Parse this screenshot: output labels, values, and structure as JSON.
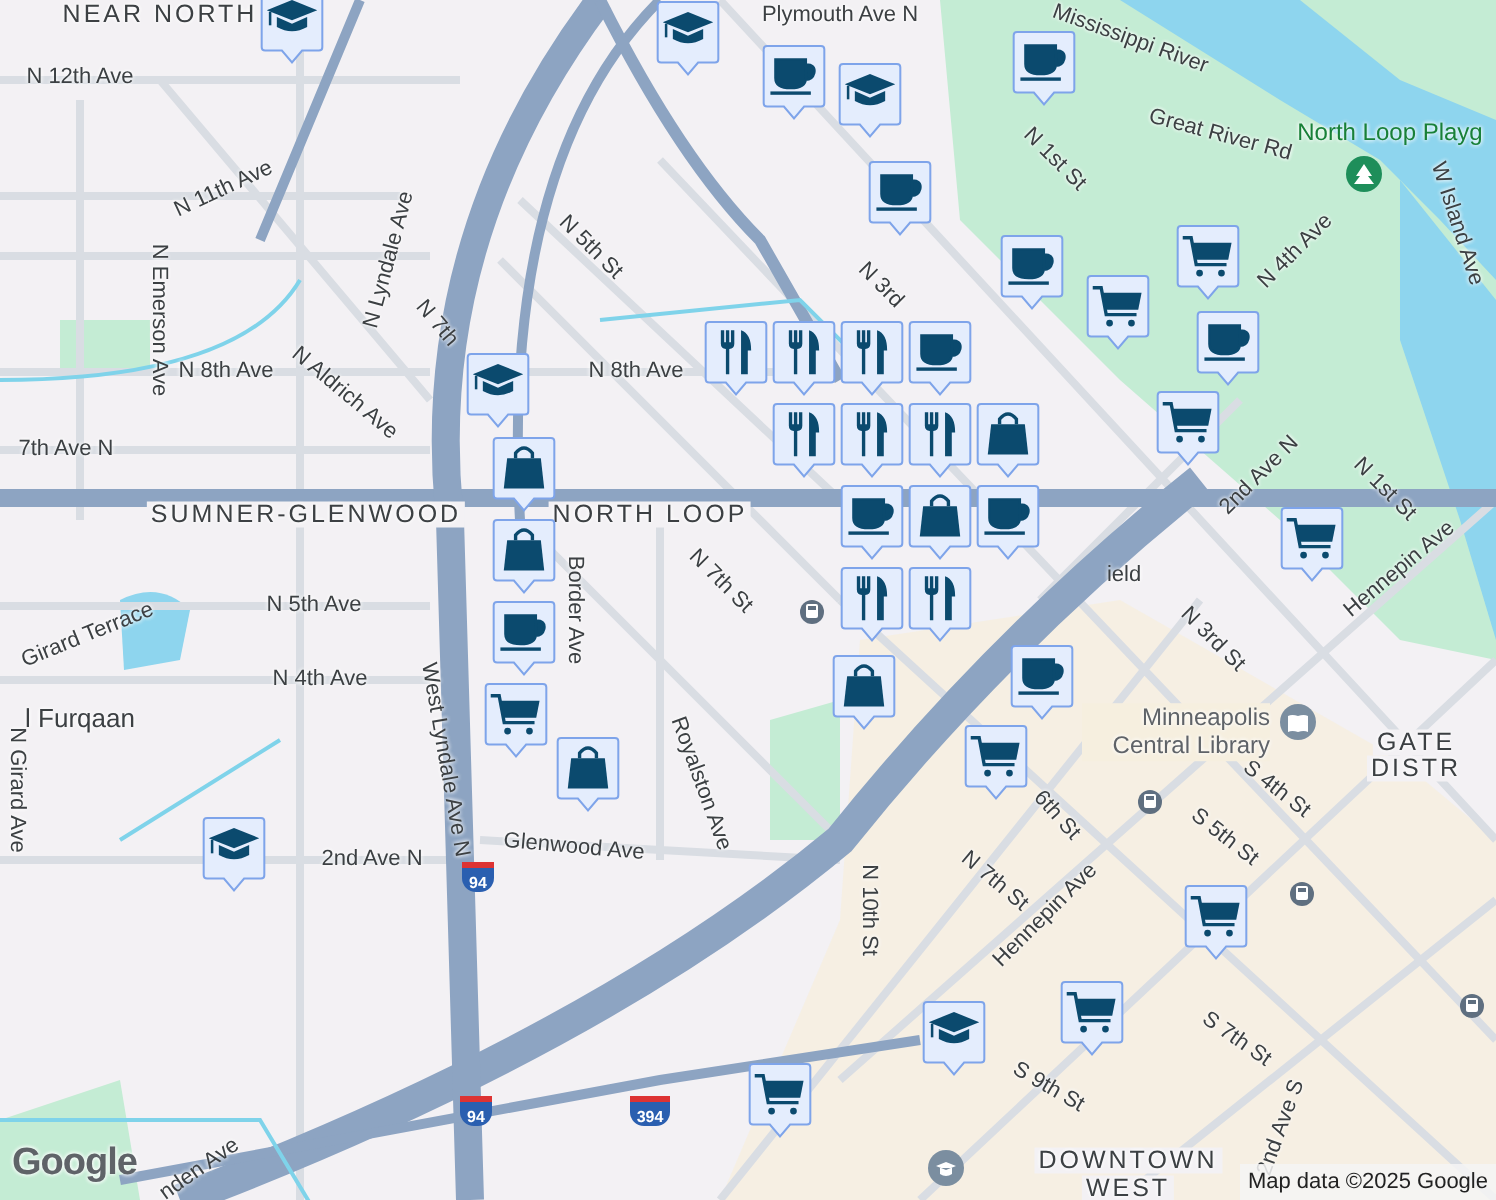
{
  "map": {
    "area_labels": [
      "NEAR NORTH",
      "SUMNER-GLENWOOD",
      "NORTH LOOP",
      "GATE",
      "DISTR",
      "DOWNTOWN",
      "WEST"
    ],
    "street_labels": [
      "N 12th Ave",
      "N 11th Ave",
      "N Emerson Ave",
      "N 8th Ave",
      "N Aldrich Ave",
      "7th Ave N",
      "N Lyndale Ave",
      "N 7th",
      "N 5th St",
      "N 8th Ave",
      "Plymouth Ave N",
      "N 7th St",
      "Border Ave",
      "N 5th Ave",
      "N 4th Ave",
      "Girard Terrace",
      "N Girard Ave",
      "2nd Ave N",
      "West Lyndale Ave N",
      "Glenwood Ave",
      "Royalston Ave",
      "nden Ave",
      "Mississippi River",
      "Great River Rd",
      "N 1st St",
      "N 3rd",
      "N 4th Ave",
      "2nd Ave N",
      "N 1st St",
      "Hennepin Ave",
      "W Island Ave",
      "ield",
      "N 3rd St",
      "S 4th St",
      "S 5th St",
      "6th St",
      "N 7th St",
      "Hennepin Ave",
      "N 10th St",
      "S 7th St",
      "S 9th St",
      "2nd Ave S",
      "l Furqaan"
    ],
    "shields": [
      "94",
      "94",
      "394"
    ],
    "pois": [
      {
        "kind": "park",
        "label": "North Loop Playg"
      },
      {
        "kind": "library",
        "label": "Minneapolis Central Library"
      },
      {
        "kind": "transit"
      },
      {
        "kind": "transit"
      },
      {
        "kind": "transit"
      },
      {
        "kind": "transit"
      },
      {
        "kind": "university"
      }
    ]
  },
  "markers": [
    {
      "kind": "school"
    },
    {
      "kind": "school"
    },
    {
      "kind": "school"
    },
    {
      "kind": "school"
    },
    {
      "kind": "school"
    },
    {
      "kind": "school"
    },
    {
      "kind": "coffee"
    },
    {
      "kind": "coffee"
    },
    {
      "kind": "coffee"
    },
    {
      "kind": "coffee"
    },
    {
      "kind": "coffee"
    },
    {
      "kind": "coffee"
    },
    {
      "kind": "coffee"
    },
    {
      "kind": "coffee"
    },
    {
      "kind": "coffee"
    },
    {
      "kind": "coffee"
    },
    {
      "kind": "restaurant"
    },
    {
      "kind": "restaurant"
    },
    {
      "kind": "restaurant"
    },
    {
      "kind": "restaurant"
    },
    {
      "kind": "restaurant"
    },
    {
      "kind": "restaurant"
    },
    {
      "kind": "restaurant"
    },
    {
      "kind": "restaurant"
    },
    {
      "kind": "shopping"
    },
    {
      "kind": "shopping"
    },
    {
      "kind": "shopping"
    },
    {
      "kind": "shopping"
    },
    {
      "kind": "shopping"
    },
    {
      "kind": "shopping"
    },
    {
      "kind": "grocery"
    },
    {
      "kind": "grocery"
    },
    {
      "kind": "grocery"
    },
    {
      "kind": "grocery"
    },
    {
      "kind": "grocery"
    },
    {
      "kind": "grocery"
    },
    {
      "kind": "grocery"
    },
    {
      "kind": "grocery"
    },
    {
      "kind": "grocery"
    }
  ],
  "logo": "Google",
  "attribution": "Map data ©2025 Google"
}
